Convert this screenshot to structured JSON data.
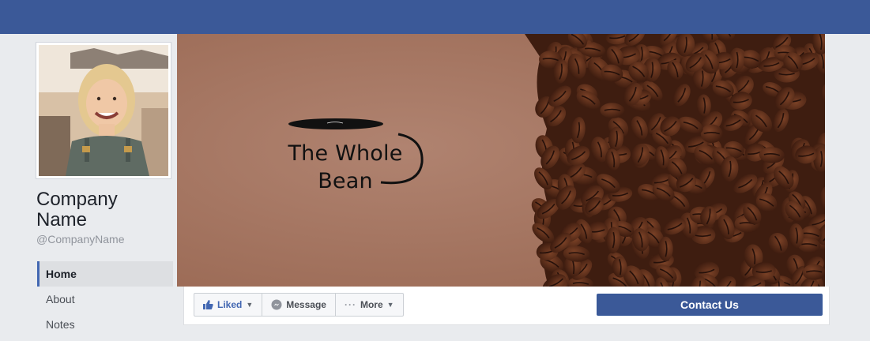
{
  "page": {
    "name": "Company Name",
    "handle": "@CompanyName"
  },
  "nav": {
    "items": [
      {
        "label": "Home",
        "active": true
      },
      {
        "label": "About",
        "active": false
      },
      {
        "label": "Notes",
        "active": false
      }
    ]
  },
  "cover": {
    "logo_line1": "The Whole",
    "logo_line2": "Bean"
  },
  "actions": {
    "liked_label": "Liked",
    "message_label": "Message",
    "more_label": "More",
    "contact_label": "Contact Us"
  },
  "colors": {
    "brand_blue": "#3b5998",
    "page_bg": "#e9ebee"
  }
}
